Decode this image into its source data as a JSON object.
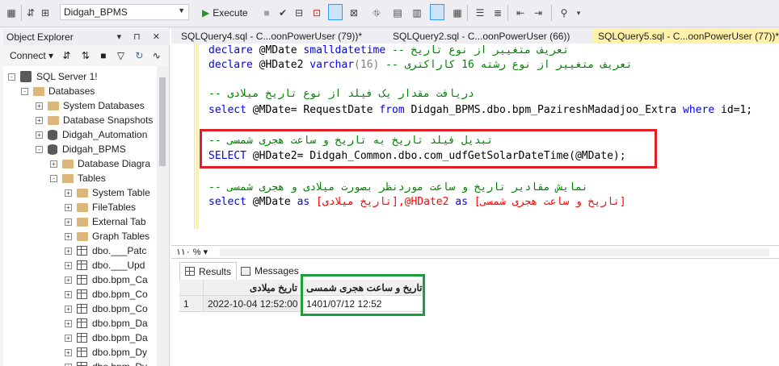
{
  "toolbar": {
    "database": "Didgah_BPMS",
    "execute_label": "Execute"
  },
  "object_explorer": {
    "title": "Object Explorer",
    "pin_controls": "▾ ⊓ ✕",
    "connect_label": "Connect",
    "tree": [
      {
        "label": "SQL Server 1!",
        "icon": "server-icon",
        "expander": "-"
      },
      {
        "label": "Databases",
        "icon": "folder-icon",
        "expander": "-"
      },
      {
        "label": "System Databases",
        "icon": "folder-icon",
        "expander": "+"
      },
      {
        "label": "Database Snapshots",
        "icon": "folder-icon",
        "expander": "+"
      },
      {
        "label": "Didgah_Automation",
        "icon": "database-icon",
        "expander": "+"
      },
      {
        "label": "Didgah_BPMS",
        "icon": "database-icon",
        "expander": "-"
      },
      {
        "label": "Database Diagra",
        "icon": "folder-icon",
        "expander": "+"
      },
      {
        "label": "Tables",
        "icon": "folder-icon",
        "expander": "-"
      },
      {
        "label": "System Table",
        "icon": "folder-icon",
        "expander": "+"
      },
      {
        "label": "FileTables",
        "icon": "folder-icon",
        "expander": "+"
      },
      {
        "label": "External Tab",
        "icon": "folder-icon",
        "expander": "+"
      },
      {
        "label": "Graph Tables",
        "icon": "folder-icon",
        "expander": "+"
      },
      {
        "label": "dbo.___Patc",
        "icon": "table-icon",
        "expander": "+"
      },
      {
        "label": "dbo.___Upd",
        "icon": "table-icon",
        "expander": "+"
      },
      {
        "label": "dbo.bpm_Ca",
        "icon": "table-icon",
        "expander": "+"
      },
      {
        "label": "dbo.bpm_Co",
        "icon": "table-icon",
        "expander": "+"
      },
      {
        "label": "dbo.bpm_Co",
        "icon": "table-icon",
        "expander": "+"
      },
      {
        "label": "dbo.bpm_Da",
        "icon": "table-icon",
        "expander": "+"
      },
      {
        "label": "dbo.bpm_Da",
        "icon": "table-icon",
        "expander": "+"
      },
      {
        "label": "dbo.bpm_Dy",
        "icon": "table-icon",
        "expander": "+"
      },
      {
        "label": "dbo.bpm_Dy",
        "icon": "table-icon",
        "expander": "+"
      }
    ]
  },
  "tabs": [
    {
      "label": "SQLQuery4.sql - C...oonPowerUser (79))*",
      "active": false
    },
    {
      "label": "SQLQuery2.sql - C...oonPowerUser (66))",
      "active": false
    },
    {
      "label": "SQLQuery5.sql - C...oonPowerUser (77))*",
      "active": true
    }
  ],
  "editor": {
    "l1_kw1": "declare",
    "l1_var": " @MDate ",
    "l1_type": "smalldatetime",
    "l1_cm": " -- تعریف متغییر از نوع تاریخ",
    "l2_kw1": "declare",
    "l2_var": " @HDate2 ",
    "l2_type": "varchar",
    "l2_rest": "(16)",
    "l2_cm": " -- تعریف متغییر از نوع رشته 16 کاراکتری",
    "l3_cm": "-- دریافت مقدار یک فیلد از نوع تاریخ میلادی",
    "l4_kw1": "select",
    "l4_a": " @MDate= RequestDate ",
    "l4_kw2": "from",
    "l4_b": " Didgah_BPMS.dbo.bpm_PazireshMadadjoo_Extra ",
    "l4_kw3": "where",
    "l4_c": " id=1;",
    "l5_cm": "-- تبدیل فیلد تاریخ به تاریخ و ساعت هجری شمسی",
    "l6_kw1": "SELECT",
    "l6_a": " @HDate2= Didgah_Common.dbo.com_udfGetSolarDateTime(@MDate);",
    "l7_cm": "-- نمایش مقادیر تاریخ و ساعت موردنظر بصورت میلادی و هجری شمسی",
    "l8_kw1": "select",
    "l8_a": " @MDate ",
    "l8_kw2": "as",
    "l8_b": " [تاریخ میلادی],@HDate2 ",
    "l8_kw3": "as",
    "l8_c": " [تاریخ و ساعت هجری شمسی]"
  },
  "zoom": "۱۱۰ %",
  "results": {
    "tab_results": "Results",
    "tab_messages": "Messages",
    "columns": [
      "تاریخ میلادی",
      "تاریخ و ساعت هجری شمسی"
    ],
    "rows": [
      {
        "num": "1",
        "mdate": "2022-10-04 12:52:00",
        "hdate": "1401/07/12 12:52"
      }
    ]
  },
  "colors": {
    "highlight_red": "#e31e24",
    "highlight_green": "#1d9e3c",
    "active_tab": "#fff1a8"
  }
}
